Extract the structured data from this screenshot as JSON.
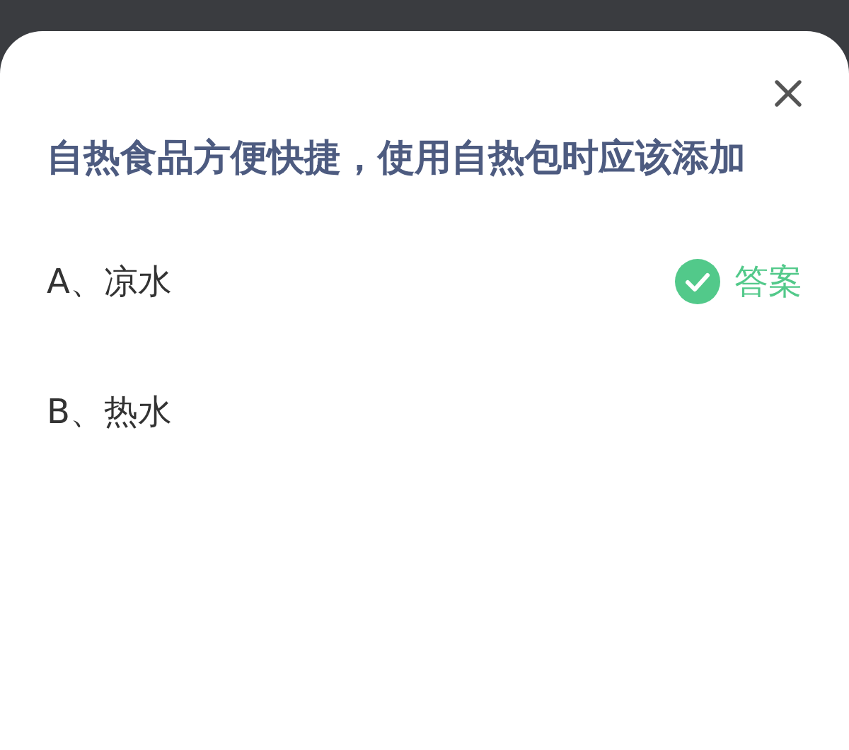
{
  "question": "自热食品方便快捷，使用自热包时应该添加",
  "options": [
    {
      "label": "A、凉水",
      "answer": true,
      "answer_label": "答案"
    },
    {
      "label": "B、热水",
      "answer": false
    }
  ]
}
